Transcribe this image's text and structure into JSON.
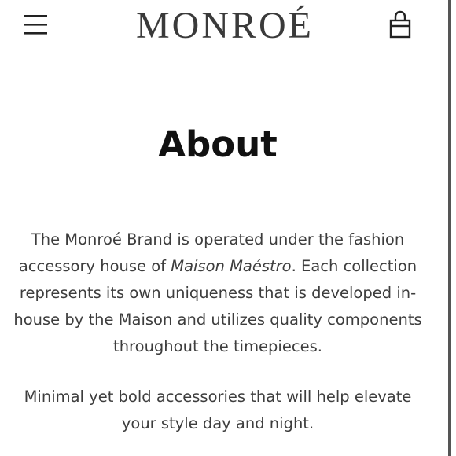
{
  "header": {
    "brand": "MONROÉ",
    "menu_icon": "hamburger-icon",
    "cart_icon": "shopping-bag-icon"
  },
  "page": {
    "title": "About"
  },
  "content": {
    "p1_before": "The Monroé Brand is operated under the fashion accessory house of ",
    "p1_emphasis": "Maison Maéstro",
    "p1_after": ". Each collection represents its own uniqueness that is developed in-house by the Maison and utilizes quality components throughout the timepieces.",
    "p2": "Minimal yet bold accessories that will help elevate your style day and night."
  }
}
